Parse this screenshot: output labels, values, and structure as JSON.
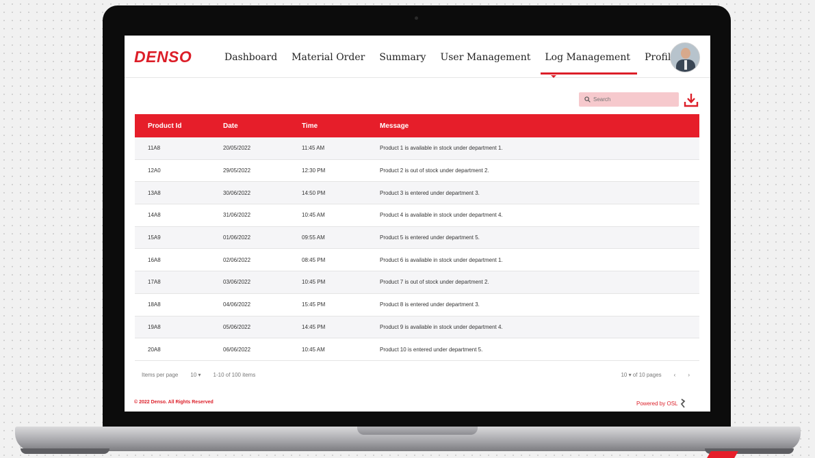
{
  "brand": {
    "logo_text": "DENSO",
    "accent_color": "#e61e2a"
  },
  "nav": {
    "items": [
      "Dashboard",
      "Material Order",
      "Summary",
      "User Management",
      "Log Management",
      "Profile"
    ],
    "active": "Log Management"
  },
  "toolbar": {
    "search_placeholder": "Search",
    "download_icon": "download-icon"
  },
  "table": {
    "headers": [
      "Product Id",
      "Date",
      "Time",
      "Message"
    ],
    "rows": [
      [
        "11A8",
        "20/05/2022",
        "11:45 AM",
        "Product 1 is available in stock under department 1."
      ],
      [
        "12A0",
        "29/05/2022",
        "12:30 PM",
        "Product 2 is out of stock under department 2."
      ],
      [
        "13A8",
        "30/06/2022",
        "14:50 PM",
        "Product 3 is entered under department 3."
      ],
      [
        "14A8",
        "31/06/2022",
        "10:45 AM",
        "Product 4 is available in stock under department 4."
      ],
      [
        "15A9",
        "01/06/2022",
        "09:55 AM",
        "Product 5 is entered under department 5."
      ],
      [
        "16A8",
        "02/06/2022",
        "08:45 PM",
        "Product 6 is available in stock under department 1."
      ],
      [
        "17A8",
        "03/06/2022",
        "10:45 PM",
        "Product 7 is out of stock under department 2."
      ],
      [
        "18A8",
        "04/06/2022",
        "15:45 PM",
        "Product 8 is entered under department 3."
      ],
      [
        "19A8",
        "05/06/2022",
        "14:45 PM",
        "Product 9 is available in stock under department 4."
      ],
      [
        "20A8",
        "06/06/2022",
        "10:45 AM",
        "Product 10 is entered under department 5."
      ]
    ]
  },
  "pagination": {
    "items_per_page_label": "Items per page",
    "items_per_page_value": "10",
    "range_text": "1-10 of 100 items",
    "page_value": "10",
    "pages_text": "of 10 pages",
    "prev_glyph": "‹",
    "next_glyph": "›"
  },
  "footer": {
    "copyright": "© 2022 Denso. All Rights Reserved",
    "powered_by": "Powered by OSL"
  }
}
